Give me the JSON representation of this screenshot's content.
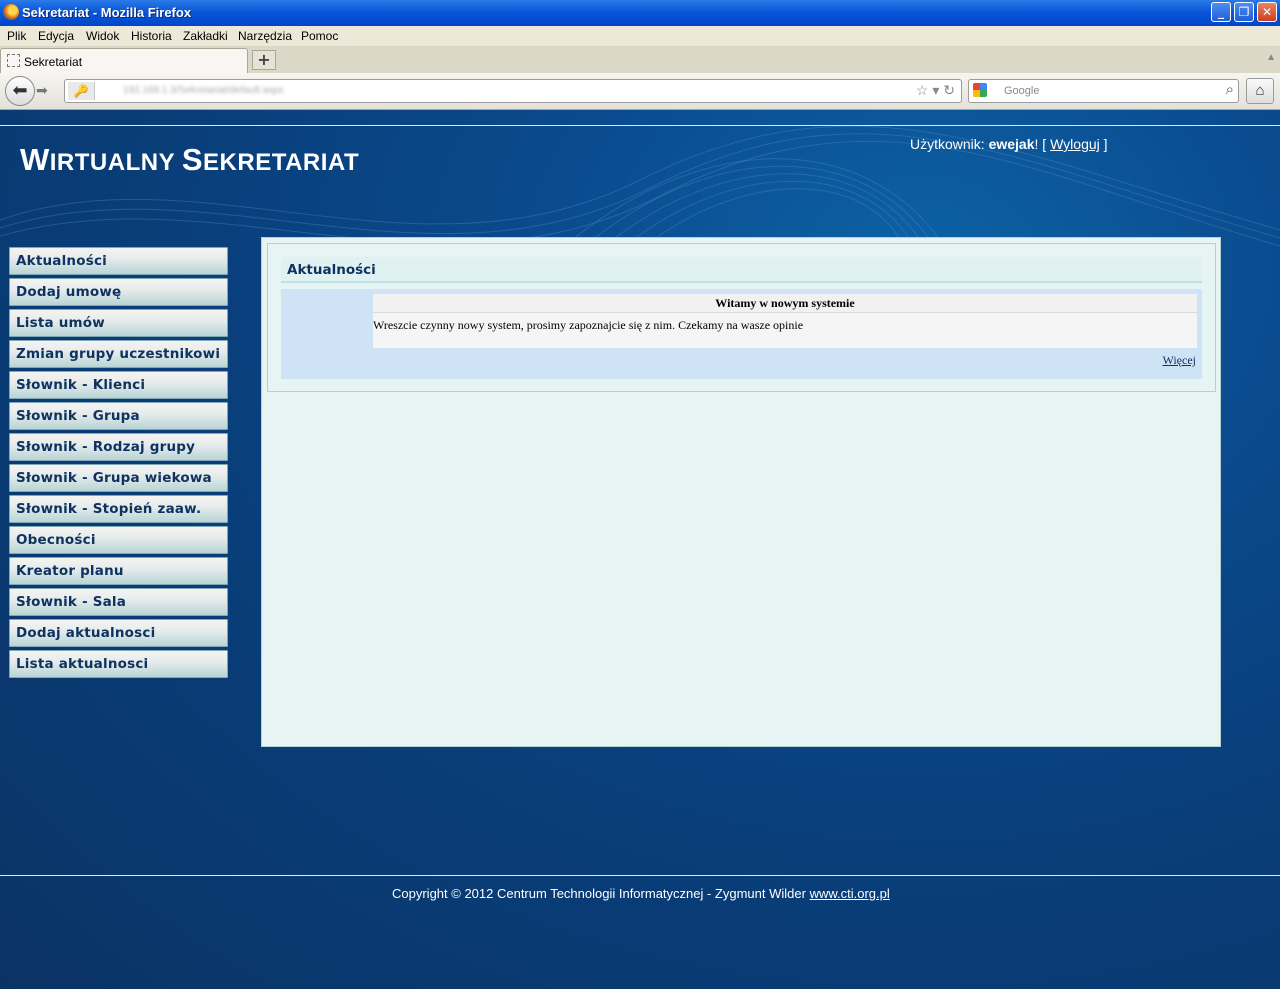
{
  "window": {
    "title": "Sekretariat - Mozilla Firefox"
  },
  "menubar": {
    "items": [
      "Plik",
      "Edycja",
      "Widok",
      "Historia",
      "Zakładki",
      "Narzędzia",
      "Pomoc"
    ]
  },
  "tab": {
    "label": "Sekretariat"
  },
  "navbar": {
    "url": "192.168.1.3/Sekretariat/default.aspx",
    "search_placeholder": "Google"
  },
  "site": {
    "title_first": "W",
    "title_rest1": "IRTUALNY ",
    "title_second": "S",
    "title_rest2": "EKRETARIAT",
    "user_label": "Użytkownik: ",
    "username": "ewejak",
    "user_suffix": "! [ ",
    "logout": "Wyloguj",
    "user_end": " ]"
  },
  "sidebar": {
    "items": [
      {
        "label": "Aktualności"
      },
      {
        "label": "Dodaj umowę"
      },
      {
        "label": "Lista umów"
      },
      {
        "label": "Zmian grupy uczestnikowi"
      },
      {
        "label": "Słownik - Klienci"
      },
      {
        "label": "Słownik - Grupa"
      },
      {
        "label": "Słownik - Rodzaj grupy"
      },
      {
        "label": "Słownik - Grupa wiekowa"
      },
      {
        "label": "Słownik - Stopień zaaw."
      },
      {
        "label": "Obecności"
      },
      {
        "label": "Kreator planu"
      },
      {
        "label": "Słownik - Sala"
      },
      {
        "label": "Dodaj aktualnosci"
      },
      {
        "label": "Lista aktualnosci"
      }
    ]
  },
  "main": {
    "heading": "Aktualności",
    "news": {
      "title": "Witamy w nowym systemie",
      "body": "Wreszcie czynny nowy system, prosimy zapoznajcie się z nim. Czekamy na wasze opinie",
      "more": "Więcej"
    }
  },
  "footer": {
    "text": "Copyright © 2012 Centrum Technologii Informatycznej - Zygmunt Wilder ",
    "link": "www.cti.org.pl"
  }
}
